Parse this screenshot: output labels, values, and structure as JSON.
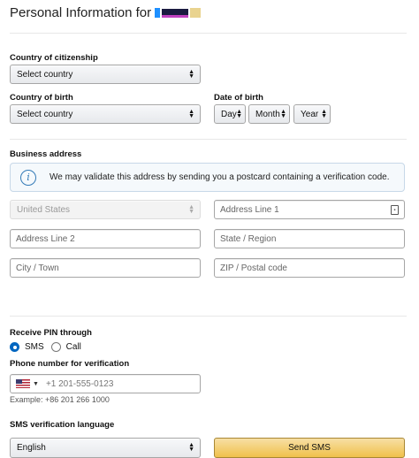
{
  "header": {
    "title": "Personal Information for"
  },
  "citizenship": {
    "label": "Country of citizenship",
    "value": "Select country"
  },
  "birth": {
    "country_label": "Country of birth",
    "country_value": "Select country",
    "date_label": "Date of birth",
    "day": "Day",
    "month": "Month",
    "year": "Year"
  },
  "address": {
    "label": "Business address",
    "info": "We may validate this address by sending you a postcard containing a verification code.",
    "country": "United States",
    "line1_placeholder": "Address Line 1",
    "line2_placeholder": "Address Line 2",
    "state_placeholder": "State / Region",
    "city_placeholder": "City / Town",
    "zip_placeholder": "ZIP / Postal code"
  },
  "pin": {
    "label": "Receive PIN through",
    "sms": "SMS",
    "call": "Call",
    "phone_label": "Phone number for verification",
    "phone_placeholder": "+1 201-555-0123",
    "example": "Example: +86 201 266 1000"
  },
  "sms_lang": {
    "label": "SMS verification language",
    "value": "English",
    "send_button": "Send SMS"
  }
}
